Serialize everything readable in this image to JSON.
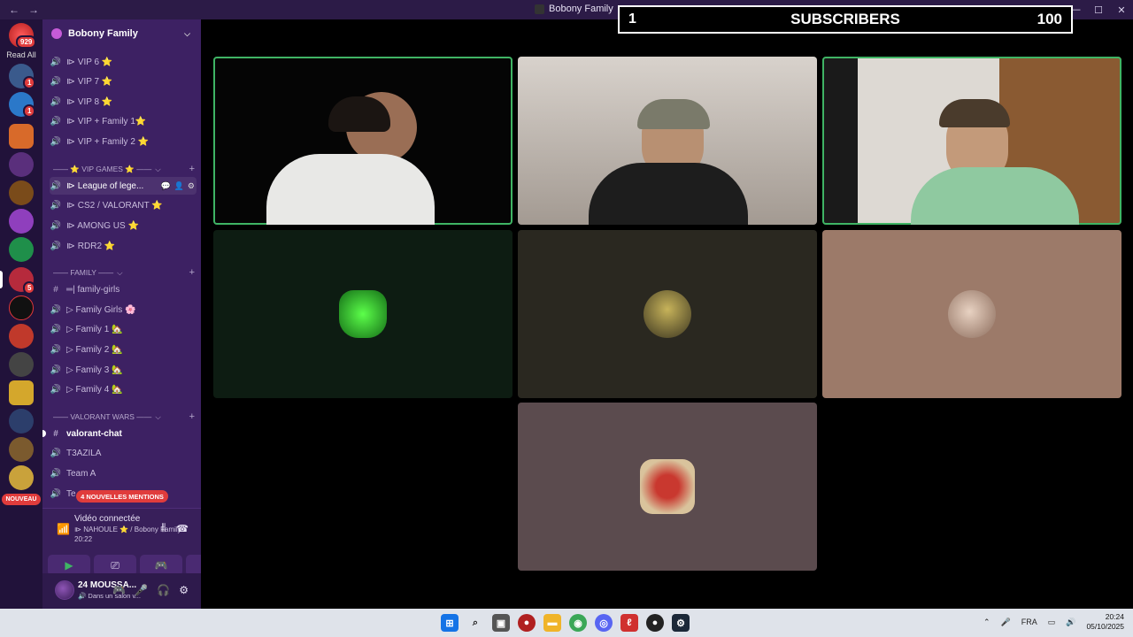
{
  "window": {
    "title": "Bobony Family",
    "nav_back": "←",
    "nav_forward": "→",
    "minimize": "—",
    "maximize": "☐",
    "close": "✕"
  },
  "server_rail": {
    "read_all_label": "Read All",
    "home_badge": "929",
    "badges": [
      "1",
      "1",
      "5"
    ],
    "new_label": "NOUVEAU"
  },
  "server": {
    "name": "Bobony Family"
  },
  "channels": [
    {
      "icon": "voice-icon",
      "name": "⧐ VIP 6 ⭐"
    },
    {
      "icon": "voice-icon",
      "name": "⧐ VIP 7 ⭐"
    },
    {
      "icon": "voice-icon",
      "name": "⧐ VIP 8 ⭐"
    },
    {
      "icon": "voice-icon",
      "name": "⧐ VIP + Family 1⭐"
    },
    {
      "icon": "voice-icon",
      "name": "⧐ VIP + Family 2 ⭐"
    }
  ],
  "category_vip_games": "—— ⭐ VIP GAMES ⭐ ——",
  "vip_games_channels": [
    {
      "name": "⧐ League of lege..."
    },
    {
      "name": "⧐ CS2 / VALORANT ⭐"
    },
    {
      "name": "⧐ AMONG US ⭐"
    },
    {
      "name": "⧐ RDR2 ⭐"
    }
  ],
  "category_family": "—— FAMILY ——",
  "family_channels": [
    {
      "icon": "#",
      "name": "═| family-girls"
    },
    {
      "icon": "🔊",
      "name": "▷ Family Girls 🌸"
    },
    {
      "icon": "🔊",
      "name": "▷ Family 1 🏡"
    },
    {
      "icon": "🔊",
      "name": "▷ Family 2 🏡"
    },
    {
      "icon": "🔊",
      "name": "▷ Family 3 🏡"
    },
    {
      "icon": "🔊",
      "name": "▷ Family 4 🏡"
    }
  ],
  "category_valorant": "—— VALORANT WARS ——",
  "valorant_channels": [
    {
      "icon": "#",
      "name": "valorant-chat"
    },
    {
      "icon": "🔊",
      "name": "T3AZILA"
    },
    {
      "icon": "🔊",
      "name": "Team A"
    },
    {
      "icon": "🔊",
      "name": "Te"
    }
  ],
  "mentions_pill": "4 NOUVELLES MENTIONS",
  "voice": {
    "status": "Vidéo connectée",
    "channel": "⧐ NAHOULE ⭐ / Bobony Family",
    "time": "20:22"
  },
  "user": {
    "name": "24 MOUSSA...",
    "status": "🔊 Dans un salon v..."
  },
  "subscribers": {
    "left": "1",
    "label": "SUBSCRIBERS",
    "right": "100"
  },
  "taskbar": {
    "language": "FRA",
    "time": "20:24",
    "date": "05/10/2025"
  }
}
